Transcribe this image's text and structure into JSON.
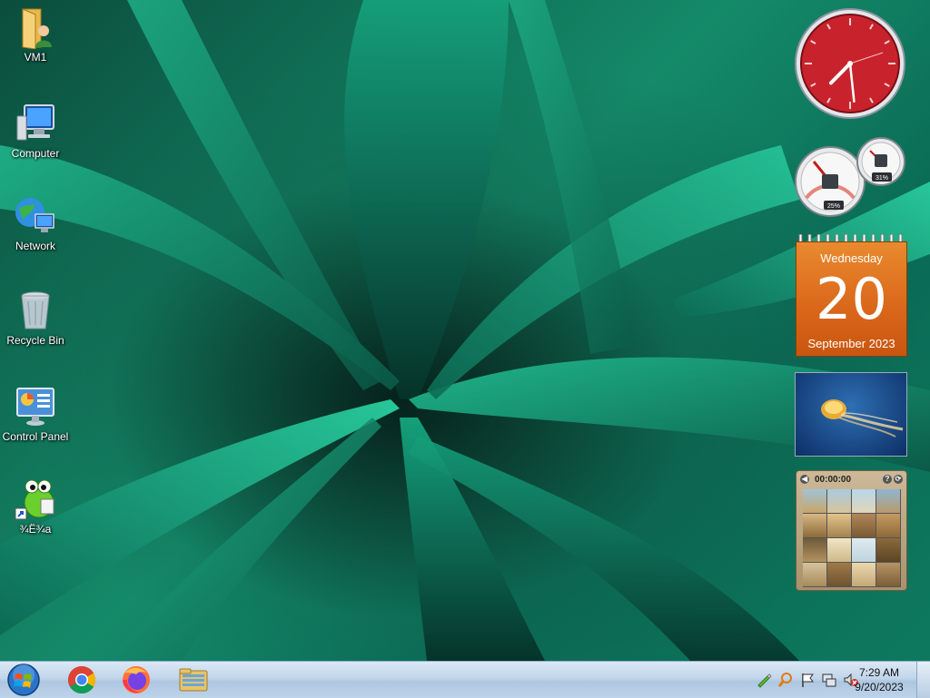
{
  "desktop": {
    "icons": [
      {
        "label": "VM1",
        "icon": "user-folder-icon"
      },
      {
        "label": "Computer",
        "icon": "computer-icon"
      },
      {
        "label": "Network",
        "icon": "network-icon"
      },
      {
        "label": "Recycle Bin",
        "icon": "recycle-bin-icon"
      },
      {
        "label": "Control Panel",
        "icon": "control-panel-icon"
      },
      {
        "label": "¾Ë¾a",
        "icon": "frog-shortcut-icon"
      }
    ]
  },
  "gadgets": {
    "clock": {
      "hour": 7,
      "minute": 29,
      "face_color": "#c8232c"
    },
    "cpu_meter": {
      "cpu": "25%",
      "memory": "31%"
    },
    "calendar": {
      "weekday": "Wednesday",
      "day": "20",
      "month_year": "September 2023",
      "color": "#d9661a"
    },
    "slideshow": {
      "subject": "jellyfish"
    },
    "puzzle": {
      "timer": "00:00:00",
      "help": "?"
    }
  },
  "taskbar": {
    "start": "windows-start-orb-icon",
    "pinned": [
      "chrome-icon",
      "firefox-icon",
      "file-explorer-icon"
    ],
    "tray": [
      "pen-icon",
      "search-magnifier-icon",
      "action-center-flag-icon",
      "network-status-icon",
      "volume-muted-icon"
    ],
    "time": "7:29 AM",
    "date": "9/20/2023"
  }
}
